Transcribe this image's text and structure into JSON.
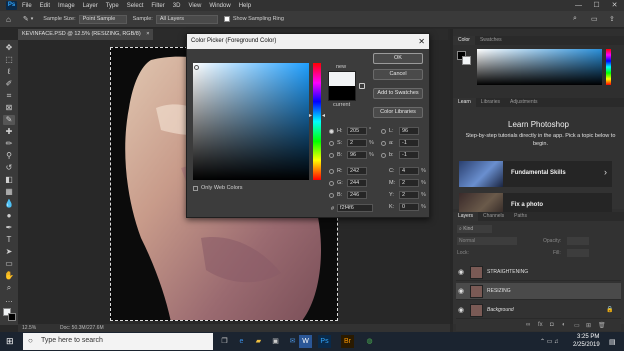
{
  "menu": {
    "app_logo": "Ps",
    "items": [
      "File",
      "Edit",
      "Image",
      "Layer",
      "Type",
      "Select",
      "Filter",
      "3D",
      "View",
      "Window",
      "Help"
    ],
    "win_min": "—",
    "win_max": "☐",
    "win_close": "✕"
  },
  "options": {
    "sample_size_label": "Sample Size:",
    "sample_size_value": "Point Sample",
    "sample_label": "Sample:",
    "sample_value": "All Layers",
    "sampling_ring_label": "Show Sampling Ring"
  },
  "document": {
    "tab_label": "KEVINFACE.PSD @ 12.5% (RESIZING, RGB/8)",
    "tab_close": "×",
    "zoom": "12.5%",
    "doc_info": "Doc: 50.3M/227.6M"
  },
  "dialog": {
    "title": "Color Picker (Foreground Color)",
    "close": "✕",
    "new_label": "new",
    "current_label": "current",
    "ok": "OK",
    "cancel": "Cancel",
    "add_to_swatches": "Add to Swatches",
    "color_libraries": "Color Libraries",
    "only_web_colors": "Only Web Colors",
    "new_color": "#f2f4f6",
    "current_color": "#000000",
    "fields": {
      "H": "205",
      "H_unit": "°",
      "S": "2",
      "S_unit": "%",
      "Bv": "96",
      "B_unit": "%",
      "R": "242",
      "G": "244",
      "Bl": "246",
      "L": "96",
      "a": "-1",
      "b": "-1",
      "C": "4",
      "M": "2",
      "Y": "2",
      "K": "0",
      "pct": "%"
    },
    "hex_label": "#",
    "hex": "f2f4f6"
  },
  "right": {
    "color_tabs": [
      "Color",
      "Swatches"
    ],
    "learn_tabs": [
      "Learn",
      "Libraries",
      "Adjustments"
    ],
    "learn_title": "Learn Photoshop",
    "learn_desc": "Step-by-step tutorials directly in the app. Pick a topic below to begin.",
    "cards": [
      {
        "title": "Fundamental Skills"
      },
      {
        "title": "Fix a photo"
      }
    ],
    "layer_tabs": [
      "Layers",
      "Channels",
      "Paths"
    ],
    "kind_label": "Kind",
    "blend": "Normal",
    "opacity_label": "Opacity:",
    "fill_label": "Fill:",
    "lock_label": "Lock:",
    "layers": [
      {
        "name": "STRAIGHTENING"
      },
      {
        "name": "RESIZING"
      },
      {
        "name": "Background"
      }
    ]
  },
  "taskbar": {
    "search_placeholder": "Type here to search",
    "time": "3:25 PM",
    "date": "2/25/2019"
  },
  "colors": {
    "ps_blue": "#31a8ff",
    "taskbar": "#1b2430"
  }
}
